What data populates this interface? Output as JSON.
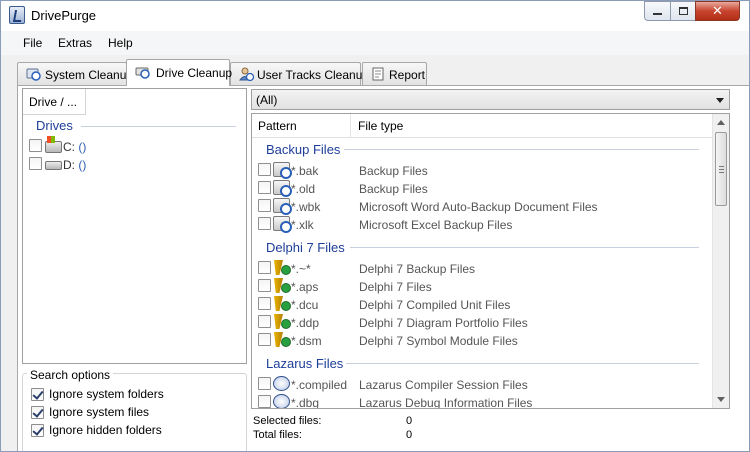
{
  "window": {
    "title": "DrivePurge"
  },
  "menu": [
    "File",
    "Extras",
    "Help"
  ],
  "tabs": [
    {
      "label": "System Cleanup",
      "icon": "system-cleanup-icon"
    },
    {
      "label": "Drive Cleanup",
      "icon": "drive-cleanup-icon",
      "active": true
    },
    {
      "label": "User Tracks Cleanup",
      "icon": "user-tracks-icon"
    },
    {
      "label": "Report",
      "icon": "report-icon"
    }
  ],
  "left": {
    "column_header": "Drive / ...",
    "group_title": "Drives",
    "drives": [
      {
        "letter": "C:",
        "paren": "()",
        "icon": "system-drive-icon"
      },
      {
        "letter": "D:",
        "paren": "()",
        "icon": "hard-drive-icon"
      }
    ]
  },
  "search_options": {
    "legend": "Search options",
    "items": [
      {
        "label": "Ignore system folders",
        "checked": true
      },
      {
        "label": "Ignore system files",
        "checked": true
      },
      {
        "label": "Ignore hidden folders",
        "checked": true
      }
    ]
  },
  "filter": {
    "selected": "(All)"
  },
  "list": {
    "headers": [
      "Pattern",
      "File type"
    ],
    "groups": [
      {
        "title": "Backup Files",
        "rows": [
          {
            "pattern": "*.bak",
            "type": "Backup Files"
          },
          {
            "pattern": "*.old",
            "type": "Backup Files"
          },
          {
            "pattern": "*.wbk",
            "type": "Microsoft Word Auto-Backup Document Files"
          },
          {
            "pattern": "*.xlk",
            "type": "Microsoft Excel Backup Files"
          }
        ]
      },
      {
        "title": "Delphi 7 Files",
        "rows": [
          {
            "pattern": "*.~*",
            "type": "Delphi 7 Backup Files"
          },
          {
            "pattern": "*.aps",
            "type": "Delphi 7 Files"
          },
          {
            "pattern": "*.dcu",
            "type": "Delphi 7 Compiled Unit Files"
          },
          {
            "pattern": "*.ddp",
            "type": "Delphi 7 Diagram Portfolio Files"
          },
          {
            "pattern": "*.dsm",
            "type": "Delphi 7 Symbol Module Files"
          }
        ]
      },
      {
        "title": "Lazarus Files",
        "rows": [
          {
            "pattern": "*.compiled",
            "type": "Lazarus Compiler Session Files"
          },
          {
            "pattern": "*.dbg",
            "type": "Lazarus Debug Information Files"
          }
        ]
      }
    ]
  },
  "status": {
    "selected_label": "Selected files:",
    "selected_value": "0",
    "total_label": "Total files:",
    "total_value": "0"
  }
}
